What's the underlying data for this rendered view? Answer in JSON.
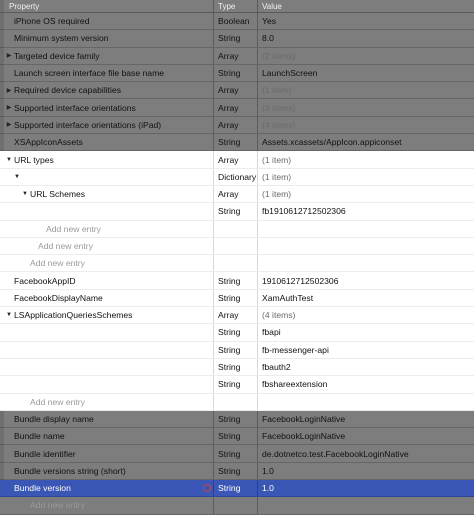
{
  "header": {
    "property": "Property",
    "type": "Type",
    "value": "Value"
  },
  "rows": [
    {
      "key": "iPhone OS required",
      "type": "Boolean",
      "value": "Yes",
      "indent": 0,
      "disc": false,
      "muted": false,
      "hl": false
    },
    {
      "key": "Minimum system version",
      "type": "String",
      "value": "8.0",
      "indent": 0,
      "disc": false,
      "muted": false,
      "hl": false
    },
    {
      "key": "Targeted device family",
      "type": "Array",
      "value": "(2 items)",
      "indent": 0,
      "disc": "right",
      "muted": true,
      "hl": false
    },
    {
      "key": "Launch screen interface file base name",
      "type": "String",
      "value": "LaunchScreen",
      "indent": 0,
      "disc": false,
      "muted": false,
      "hl": false
    },
    {
      "key": "Required device capabilities",
      "type": "Array",
      "value": "(1 item)",
      "indent": 0,
      "disc": "right",
      "muted": true,
      "hl": false
    },
    {
      "key": "Supported interface orientations",
      "type": "Array",
      "value": "(3 items)",
      "indent": 0,
      "disc": "right",
      "muted": true,
      "hl": false
    },
    {
      "key": "Supported interface orientations (iPad)",
      "type": "Array",
      "value": "(4 items)",
      "indent": 0,
      "disc": "right",
      "muted": true,
      "hl": false
    },
    {
      "key": "XSAppIconAssets",
      "type": "String",
      "value": "Assets.xcassets/AppIcon.appiconset",
      "indent": 0,
      "disc": false,
      "muted": false,
      "hl": false
    },
    {
      "key": "URL types",
      "type": "Array",
      "value": "(1 item)",
      "indent": 0,
      "disc": "down",
      "muted": true,
      "hl": true
    },
    {
      "key": "",
      "type": "Dictionary",
      "value": "(1 item)",
      "indent": 1,
      "disc": "down",
      "muted": true,
      "hl": true
    },
    {
      "key": "URL Schemes",
      "type": "Array",
      "value": "(1 item)",
      "indent": 2,
      "disc": "down",
      "muted": true,
      "hl": true
    },
    {
      "key": "",
      "type": "String",
      "value": "fb1910612712502306",
      "indent": 3,
      "disc": false,
      "muted": false,
      "hl": true
    },
    {
      "key": "Add new entry",
      "type": "",
      "value": "",
      "indent": 4,
      "disc": false,
      "muted": false,
      "hl": true,
      "add": true
    },
    {
      "key": "Add new entry",
      "type": "",
      "value": "",
      "indent": 3,
      "disc": false,
      "muted": false,
      "hl": true,
      "add": true
    },
    {
      "key": "Add new entry",
      "type": "",
      "value": "",
      "indent": 2,
      "disc": false,
      "muted": false,
      "hl": true,
      "add": true
    },
    {
      "key": "FacebookAppID",
      "type": "String",
      "value": "1910612712502306",
      "indent": 0,
      "disc": false,
      "muted": false,
      "hl": true
    },
    {
      "key": "FacebookDisplayName",
      "type": "String",
      "value": "XamAuthTest",
      "indent": 0,
      "disc": false,
      "muted": false,
      "hl": true
    },
    {
      "key": "LSApplicationQueriesSchemes",
      "type": "Array",
      "value": "(4 items)",
      "indent": 0,
      "disc": "down",
      "muted": true,
      "hl": true
    },
    {
      "key": "",
      "type": "String",
      "value": "fbapi",
      "indent": 1,
      "disc": false,
      "muted": false,
      "hl": true
    },
    {
      "key": "",
      "type": "String",
      "value": "fb-messenger-api",
      "indent": 1,
      "disc": false,
      "muted": false,
      "hl": true
    },
    {
      "key": "",
      "type": "String",
      "value": "fbauth2",
      "indent": 1,
      "disc": false,
      "muted": false,
      "hl": true
    },
    {
      "key": "",
      "type": "String",
      "value": "fbshareextension",
      "indent": 1,
      "disc": false,
      "muted": false,
      "hl": true
    },
    {
      "key": "Add new entry",
      "type": "",
      "value": "",
      "indent": 2,
      "disc": false,
      "muted": false,
      "hl": true,
      "add": true
    },
    {
      "key": "Bundle display name",
      "type": "String",
      "value": "FacebookLoginNative",
      "indent": 0,
      "disc": false,
      "muted": false,
      "hl": false
    },
    {
      "key": "Bundle name",
      "type": "String",
      "value": "FacebookLoginNative",
      "indent": 0,
      "disc": false,
      "muted": false,
      "hl": false
    },
    {
      "key": "Bundle identifier",
      "type": "String",
      "value": "de.dotnetco.test.FacebookLoginNative",
      "indent": 0,
      "disc": false,
      "muted": false,
      "hl": false
    },
    {
      "key": "Bundle versions string (short)",
      "type": "String",
      "value": "1.0",
      "indent": 0,
      "disc": false,
      "muted": false,
      "hl": false
    },
    {
      "key": "Bundle version",
      "type": "String",
      "value": "1.0",
      "indent": 0,
      "disc": false,
      "muted": false,
      "hl": false,
      "selected": true
    },
    {
      "key": "Add new entry",
      "type": "",
      "value": "",
      "indent": 2,
      "disc": false,
      "muted": false,
      "hl": false,
      "add": true
    }
  ]
}
